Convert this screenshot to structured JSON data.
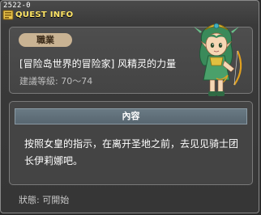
{
  "window": {
    "quest_id": "2522-0",
    "title": "QUEST INFO",
    "title_icon": "quest-book-icon"
  },
  "info": {
    "job_label": "職業",
    "quest_name": "[冒险岛世界的冒险家] 风精灵的力量",
    "level_requirement": "建議等級: 70～74",
    "npc": "elf-archer-npc-portrait"
  },
  "content": {
    "header": "內容",
    "text": "按照女皇的指示，在离开圣地之前，去见见骑士团长伊莉娜吧。"
  },
  "status": {
    "text": "狀態: 可開始"
  },
  "colors": {
    "title": "#ffe566",
    "job_badge": "#c9b393",
    "header_bar": "#6a7a84"
  }
}
